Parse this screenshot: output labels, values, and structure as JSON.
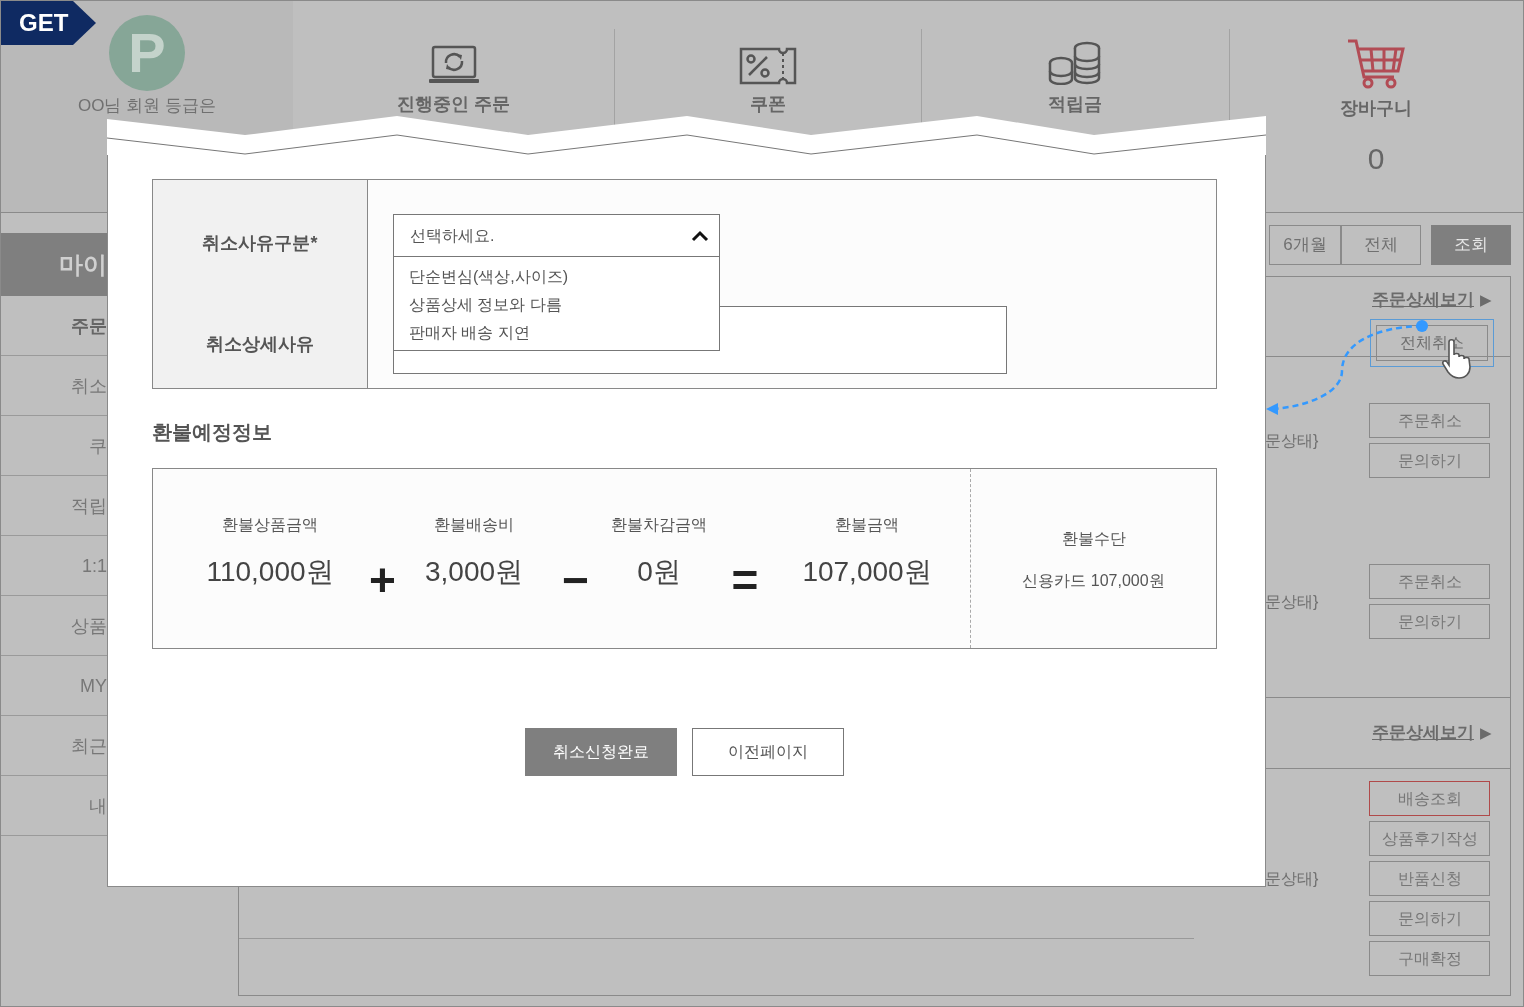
{
  "badge": {
    "label": "GET"
  },
  "header": {
    "profile": {
      "initial": "P",
      "grade_text": "OO님 회원 등급은"
    },
    "shortcuts": [
      {
        "kind": "laptop",
        "label": "진행중인 주문"
      },
      {
        "kind": "coupon",
        "label": "쿠폰"
      },
      {
        "kind": "coins",
        "label": "적립금"
      },
      {
        "kind": "cart",
        "label": "장바구니",
        "count": "0"
      }
    ]
  },
  "sidebar": {
    "title": "마이",
    "items": [
      {
        "label": "주문",
        "selected": true
      },
      {
        "label": "취소",
        "selected": false
      },
      {
        "label": "쿠",
        "selected": false
      },
      {
        "label": "적립",
        "selected": false
      },
      {
        "label": "1:1",
        "selected": false
      },
      {
        "label": "상품",
        "selected": false
      },
      {
        "label": "MY",
        "selected": false
      },
      {
        "label": "최근",
        "selected": false
      },
      {
        "label": "내",
        "selected": false
      }
    ]
  },
  "filters": [
    {
      "label": "6개월",
      "kind": "period"
    },
    {
      "label": "전체",
      "kind": "period"
    },
    {
      "label": "조회",
      "kind": "submit"
    }
  ],
  "orders": [
    {
      "detail_link": "주문상세보기",
      "arrow": "▶",
      "cancel_all": "전체취소",
      "items": [
        {
          "status": "문상태}",
          "actions": [
            {
              "label": "주문취소",
              "highlighted": false
            },
            {
              "label": "문의하기",
              "highlighted": false
            }
          ]
        },
        {
          "status": "문상태}",
          "actions": [
            {
              "label": "주문취소",
              "highlighted": false
            },
            {
              "label": "문의하기",
              "highlighted": false
            }
          ]
        }
      ]
    },
    {
      "detail_link": "주문상세보기",
      "arrow": "▶",
      "items": [
        {
          "status": "문상태}",
          "actions": [
            {
              "label": "배송조회",
              "highlighted": true
            },
            {
              "label": "상품후기작성",
              "highlighted": false
            },
            {
              "label": "반품신청",
              "highlighted": false
            },
            {
              "label": "문의하기",
              "highlighted": false
            },
            {
              "label": "구매확정",
              "highlighted": false
            }
          ]
        }
      ]
    }
  ],
  "modal": {
    "fields": [
      {
        "kind": "select",
        "label": "취소사유구분*",
        "value": "선택하세요.",
        "expanded": true,
        "options": [
          "단순변심(색상,사이즈)",
          "상품상세 정보와 다름",
          "판매자 배송 지연"
        ]
      },
      {
        "kind": "textarea",
        "label": "취소상세사유"
      }
    ],
    "refund": {
      "title": "환불예정정보",
      "amounts": [
        {
          "label": "환불상품금액",
          "value": "110,000원",
          "operator_after": "+"
        },
        {
          "label": "환불배송비",
          "value": "3,000원",
          "operator_after": "−"
        },
        {
          "label": "환불차감금액",
          "value": "0원",
          "operator_after": "="
        },
        {
          "label": "환불금액",
          "value": "107,000원"
        }
      ],
      "method": {
        "label": "환불수단",
        "value": "신용카드 107,000원"
      }
    },
    "buttons": [
      {
        "label": "취소신청완료",
        "kind": "primary"
      },
      {
        "label": "이전페이지",
        "kind": "secondary"
      }
    ]
  }
}
